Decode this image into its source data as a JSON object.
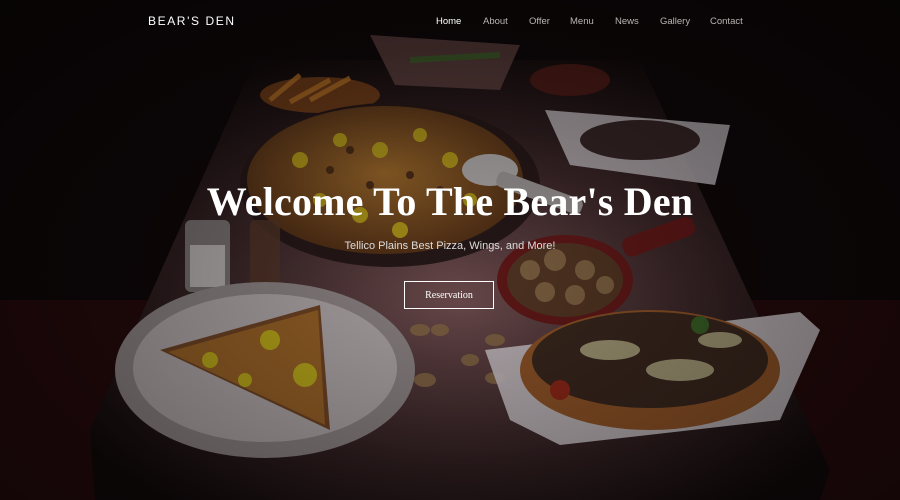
{
  "brand": "BEAR'S DEN",
  "nav": {
    "items": [
      {
        "label": "Home",
        "active": true
      },
      {
        "label": "About",
        "active": false
      },
      {
        "label": "Offer",
        "active": false
      },
      {
        "label": "Menu",
        "active": false
      },
      {
        "label": "News",
        "active": false
      },
      {
        "label": "Gallery",
        "active": false
      },
      {
        "label": "Contact",
        "active": false
      }
    ]
  },
  "hero": {
    "title": "Welcome To The Bear's Den",
    "subtitle": "Tellico Plains Best Pizza, Wings, and More!",
    "button_label": "Reservation"
  },
  "colors": {
    "text": "#ffffff",
    "nav_inactive": "#b9b4b4",
    "background": "#0b0708"
  }
}
